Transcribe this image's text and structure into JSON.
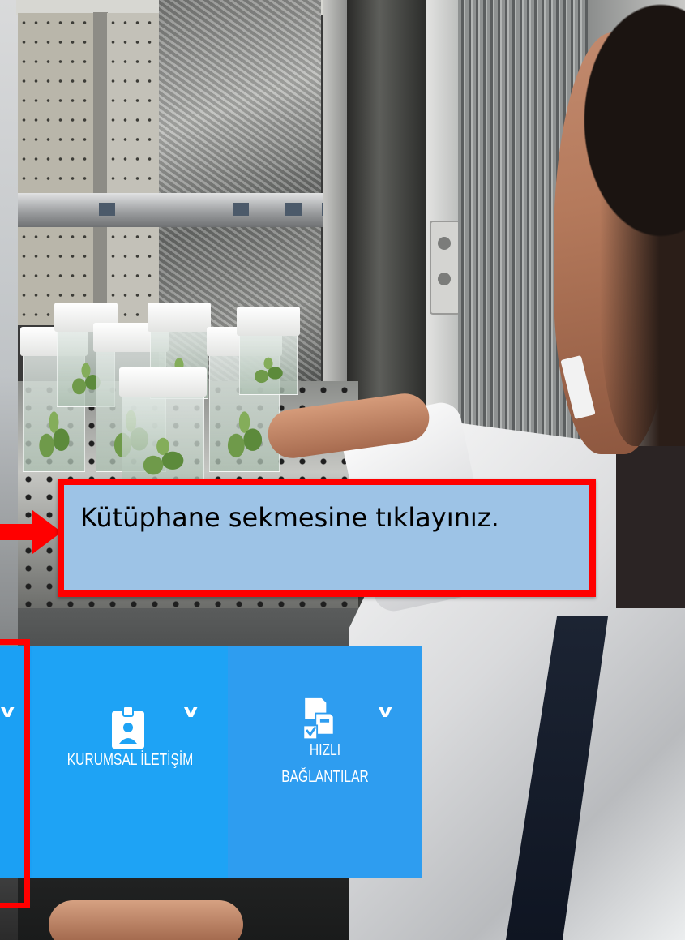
{
  "callout": {
    "text": "Kütüphane sekmesine tıklayınız."
  },
  "menu": {
    "tiles": [
      {
        "label": "KURUMSAL İLETİŞİM",
        "icon": "id-badge-icon",
        "chevron": "v"
      },
      {
        "label_line1": "HIZLI",
        "label_line2": "BAĞLANTILAR",
        "icon": "linked-documents-icon",
        "chevron": "v"
      }
    ],
    "hidden_tile_chevron": "v"
  },
  "colors": {
    "tile_blue": "#1ea3f5",
    "callout_fill": "#9dc3e6",
    "annotation_red": "#ff0000"
  }
}
